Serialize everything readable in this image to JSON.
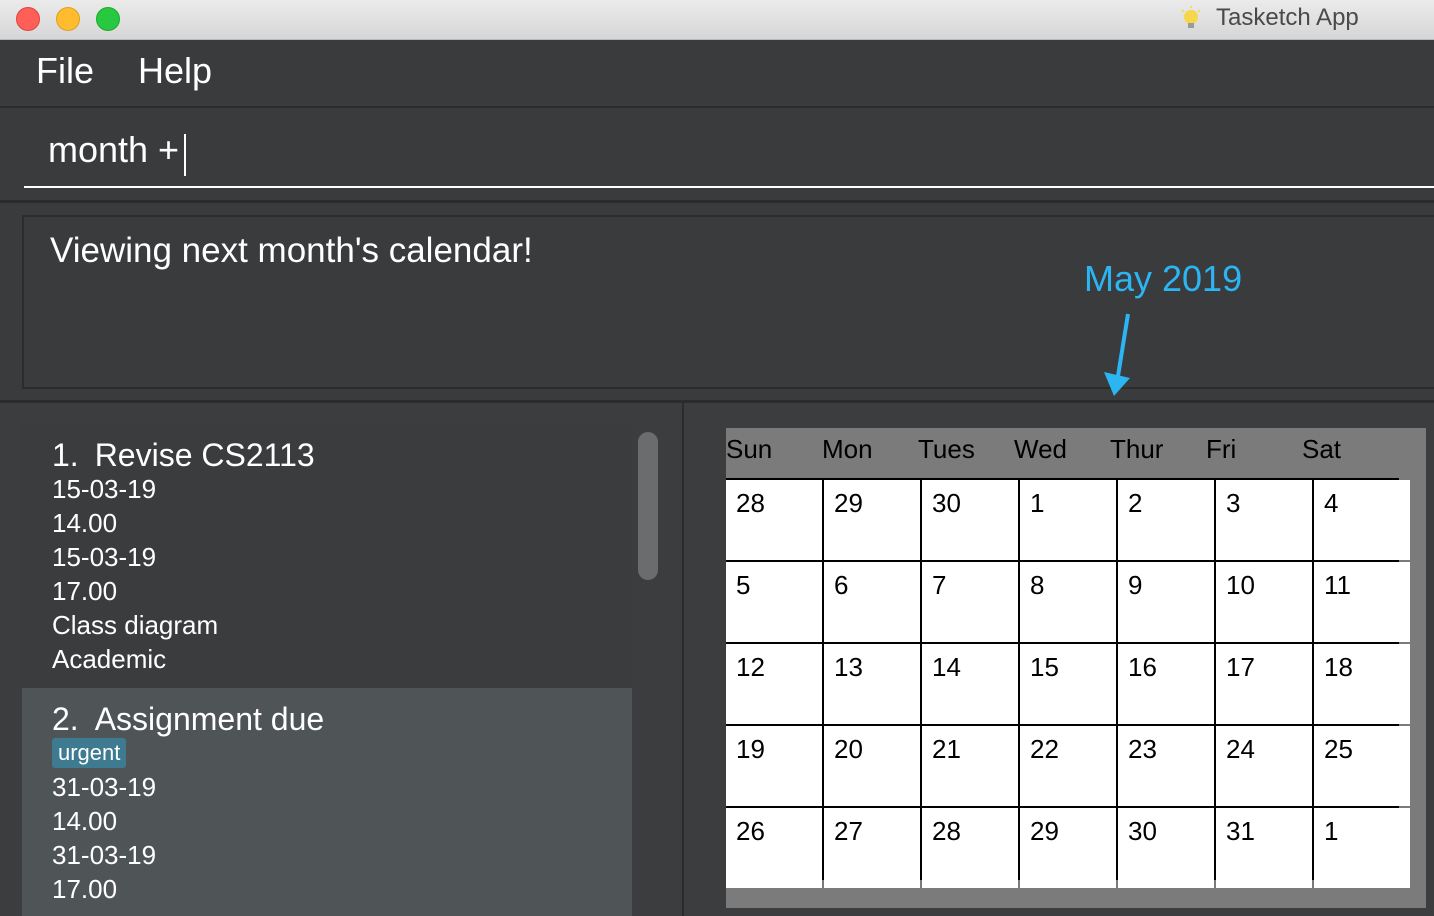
{
  "window": {
    "title": "Tasketch App"
  },
  "menu": {
    "file": "File",
    "help": "Help"
  },
  "command": {
    "value": "month +"
  },
  "result": {
    "text": "Viewing next month's calendar!"
  },
  "annotation": {
    "text": "May 2019"
  },
  "tasks": [
    {
      "index": "1.",
      "title": "Revise CS2113",
      "lines": [
        "15-03-19",
        "14.00",
        "15-03-19",
        "17.00",
        "Class diagram",
        "Academic"
      ]
    },
    {
      "index": "2.",
      "title": "Assignment due",
      "tag": "urgent",
      "lines": [
        "31-03-19",
        "14.00",
        "31-03-19",
        "17.00"
      ]
    }
  ],
  "calendar": {
    "days": [
      "Sun",
      "Mon",
      "Tues",
      "Wed",
      "Thur",
      "Fri",
      "Sat"
    ],
    "weeks": [
      [
        "28",
        "29",
        "30",
        "1",
        "2",
        "3",
        "4"
      ],
      [
        "5",
        "6",
        "7",
        "8",
        "9",
        "10",
        "11"
      ],
      [
        "12",
        "13",
        "14",
        "15",
        "16",
        "17",
        "18"
      ],
      [
        "19",
        "20",
        "21",
        "22",
        "23",
        "24",
        "25"
      ],
      [
        "26",
        "27",
        "28",
        "29",
        "30",
        "31",
        "1"
      ]
    ]
  },
  "colors": {
    "background": "#3c3d3f",
    "annotation": "#2bb5f2",
    "tag": "#3e7b91",
    "selected_card": "#4f5457",
    "calendar_frame": "#7b7b7b"
  }
}
